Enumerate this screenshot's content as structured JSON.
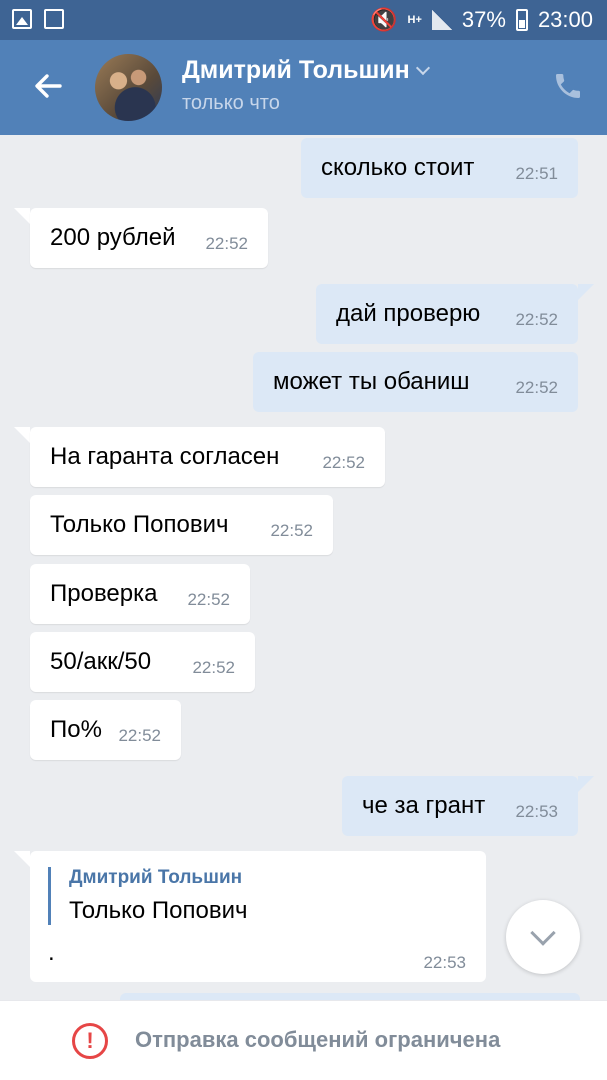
{
  "status_bar": {
    "battery": "37%",
    "time": "23:00",
    "network": "H+"
  },
  "header": {
    "name": "Дмитрий Тольшин",
    "status": "только что"
  },
  "messages": [
    {
      "dir": "out",
      "text": "сколько стоит",
      "time": "22:51"
    },
    {
      "dir": "in",
      "text": "200 рублей",
      "time": "22:52"
    },
    {
      "dir": "out",
      "text": "дай проверю",
      "time": "22:52"
    },
    {
      "dir": "out",
      "text": "может ты обаниш",
      "time": "22:52"
    },
    {
      "dir": "in",
      "text": "На гаранта согласен",
      "time": "22:52"
    },
    {
      "dir": "in",
      "text": "Только Попович",
      "time": "22:52"
    },
    {
      "dir": "in",
      "text": "Проверка",
      "time": "22:52"
    },
    {
      "dir": "in",
      "text": "50/акк/50",
      "time": "22:52"
    },
    {
      "dir": "in",
      "text": "По%",
      "time": "22:52"
    },
    {
      "dir": "out",
      "text": "че за грант",
      "time": "22:53"
    }
  ],
  "reply": {
    "quoted_name": "Дмитрий Тольшин",
    "quoted_text": "Только Попович",
    "text": ".",
    "time": "22:53"
  },
  "footer": {
    "text": "Отправка сообщений ограничена",
    "icon": "!"
  }
}
